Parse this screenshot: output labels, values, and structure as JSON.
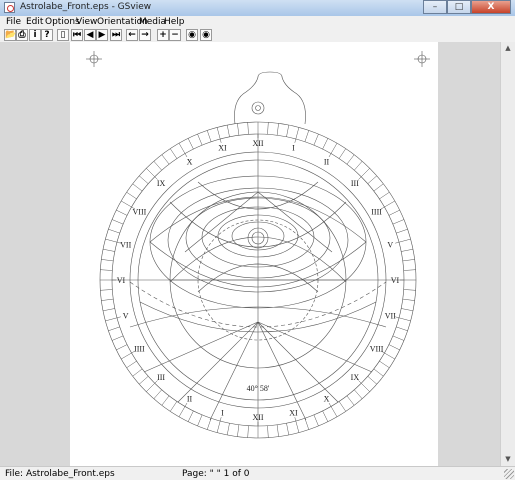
{
  "window": {
    "title": "Astrolabe_Front.eps - GSview",
    "min": "–",
    "max": "□",
    "close": "X"
  },
  "menu": [
    "File",
    "Edit",
    "Options",
    "View",
    "Orientation",
    "Media",
    "Help"
  ],
  "toolbar": [
    {
      "name": "open-icon",
      "glyph": "📂"
    },
    {
      "name": "print-icon",
      "glyph": "⎙"
    },
    {
      "name": "info-icon",
      "glyph": "i"
    },
    {
      "name": "help-icon",
      "glyph": "?"
    },
    {
      "name": "page-goto-icon",
      "glyph": "▯"
    },
    {
      "name": "first-page-icon",
      "glyph": "⏮"
    },
    {
      "name": "prev-page-icon",
      "glyph": "◀"
    },
    {
      "name": "next-page-icon",
      "glyph": "▶"
    },
    {
      "name": "last-page-icon",
      "glyph": "⏭"
    },
    {
      "name": "back-icon",
      "glyph": "←"
    },
    {
      "name": "forward-icon",
      "glyph": "→"
    },
    {
      "name": "zoom-in-icon",
      "glyph": "+"
    },
    {
      "name": "zoom-out-icon",
      "glyph": "−"
    },
    {
      "name": "view-icon",
      "glyph": "◉"
    },
    {
      "name": "view-alt-icon",
      "glyph": "◉"
    }
  ],
  "document": {
    "latitude": "40° 58'",
    "hours": [
      "XII",
      "I",
      "II",
      "III",
      "IIII",
      "V",
      "VI",
      "VII",
      "VIII",
      "IX",
      "X",
      "XI",
      "XII",
      "I",
      "II",
      "III",
      "IIII",
      "V",
      "VI",
      "VII",
      "VIII",
      "IX",
      "X",
      "XI"
    ]
  },
  "status": {
    "file": "File: Astrolabe_Front.eps",
    "page": "Page: \" \"   1 of 0"
  }
}
